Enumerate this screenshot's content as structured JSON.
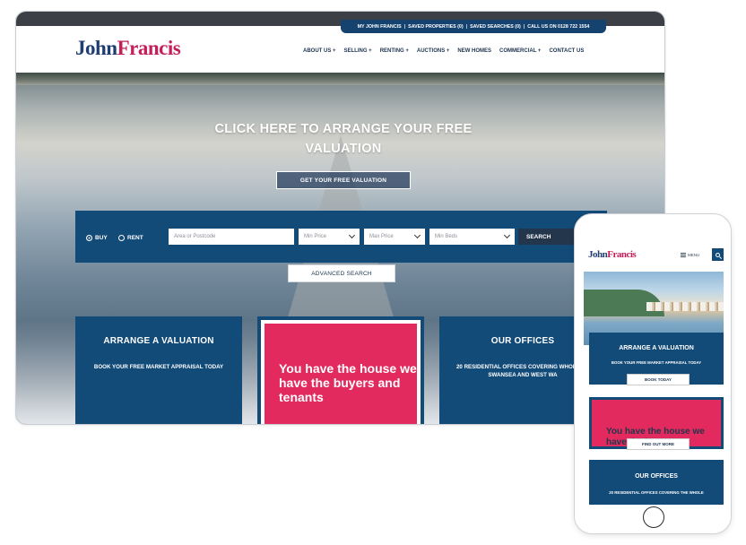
{
  "desktop": {
    "logo": {
      "part1": "John",
      "part2": "Francis"
    },
    "utility_bar": [
      "MY JOHN FRANCIS",
      "SAVED PROPERTIES (0)",
      "SAVED SEARCHES (0)",
      "CALL US ON 0128 722 1554"
    ],
    "nav": [
      "ABOUT US +",
      "SELLING +",
      "RENTING +",
      "AUCTIONS +",
      "NEW HOMES",
      "COMMERCIAL +",
      "CONTACT US"
    ],
    "hero": {
      "title": "CLICK HERE TO ARRANGE YOUR FREE VALUATION",
      "button": "GET YOUR FREE VALUATION"
    },
    "search": {
      "buy": "BUY",
      "rent": "RENT",
      "area_placeholder": "Area or Postcode",
      "min_price": "Min Price",
      "max_price": "Max Price",
      "min_beds": "Min Beds",
      "search_button": "SEARCH",
      "advanced": "ADVANCED SEARCH"
    },
    "cards": {
      "valuation_title": "ARRANGE A VALUATION",
      "valuation_sub": "BOOK YOUR FREE MARKET APPRAISAL TODAY",
      "promo": "You have the house we have the buyers and tenants",
      "offices_title": "OUR OFFICES",
      "offices_sub": "20 RESIDENTIAL OFFICES COVERING WHOLE OF SWANSEA AND WEST WA"
    }
  },
  "mobile": {
    "logo": {
      "part1": "John",
      "part2": "Francis"
    },
    "menu": "MENU",
    "valuation_title": "ARRANGE A VALUATION",
    "valuation_sub": "BOOK YOUR FREE MARKET APPRAISAL TODAY",
    "book_button": "BOOK TODAY",
    "promo": "You have the house we have the buyers",
    "find_button": "FIND OUT MORE",
    "offices_title": "OUR OFFICES",
    "offices_sub": "20 RESIDENTIAL OFFICES COVERING THE WHOLE"
  },
  "colors": {
    "navy": "#124a78",
    "pink": "#e22a5e",
    "logo_blue": "#1f3e73",
    "logo_red": "#c41f5a"
  }
}
